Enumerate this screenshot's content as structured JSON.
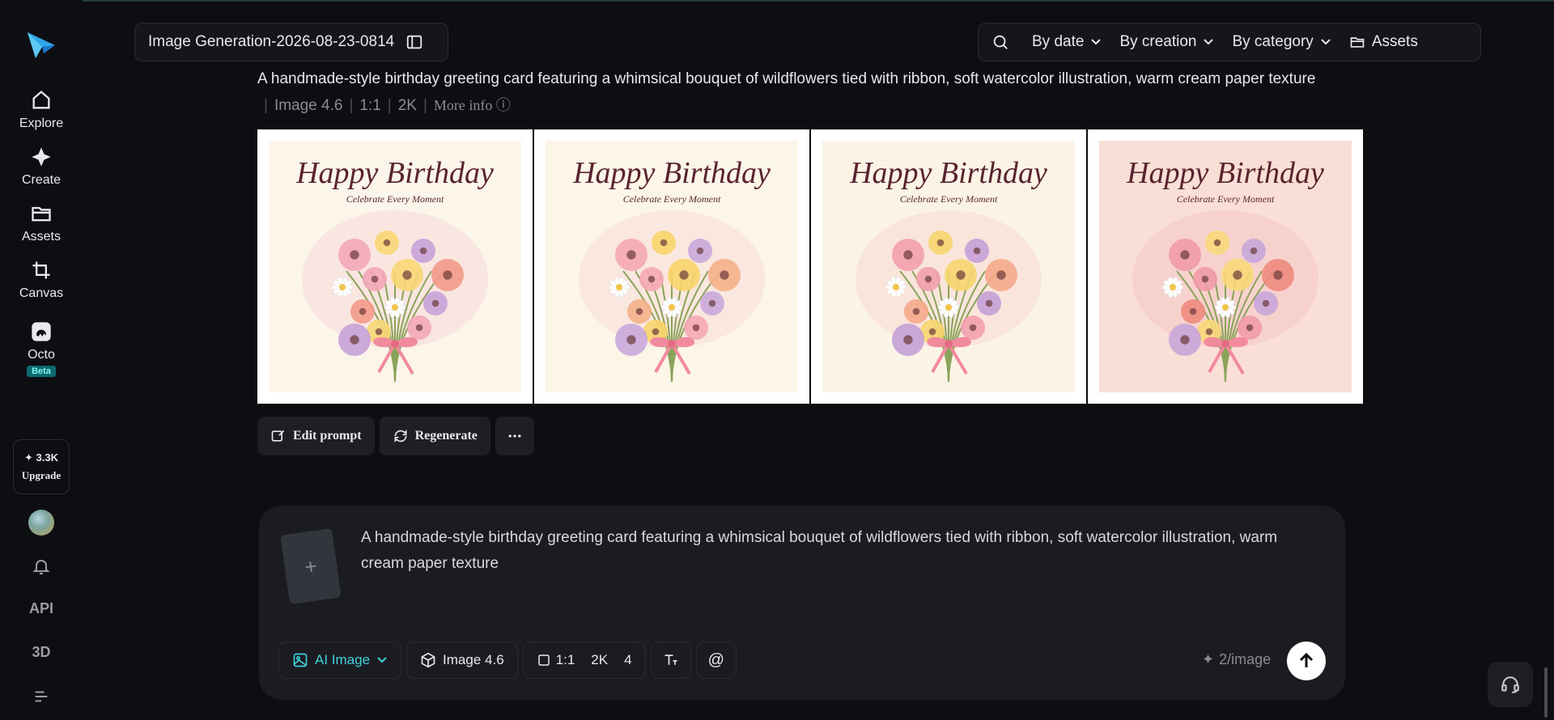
{
  "sidebar": {
    "items": [
      {
        "label": "Explore",
        "icon": "home-icon"
      },
      {
        "label": "Create",
        "icon": "diamond-icon"
      },
      {
        "label": "Assets",
        "icon": "folder-icon"
      },
      {
        "label": "Canvas",
        "icon": "crop-icon"
      },
      {
        "label": "Octo",
        "icon": "octo-icon",
        "badge": "Beta"
      }
    ],
    "upgrade": {
      "credits": "3.3K",
      "label": "Upgrade"
    },
    "api_label": "API",
    "three_d_label": "3D"
  },
  "header": {
    "title": "Image Generation-2026-08-23-0814",
    "filters": [
      "By date",
      "By creation",
      "By category"
    ],
    "assets_label": "Assets"
  },
  "result": {
    "prompt": "A handmade-style birthday greeting card featuring a whimsical bouquet of wildflowers tied with ribbon, soft watercolor illustration, warm cream paper texture",
    "model": "Image 4.6",
    "ratio": "1:1",
    "resolution": "2K",
    "more_info": "More info",
    "card_title": "Happy Birthday",
    "card_subtitle": "Celebrate Every Moment",
    "actions": {
      "edit": "Edit prompt",
      "regenerate": "Regenerate"
    }
  },
  "composer": {
    "text": "A handmade-style birthday greeting card featuring a whimsical bouquet of wildflowers tied with ribbon, soft watercolor illustration, warm cream paper texture",
    "mode": "AI Image",
    "model": "Image 4.6",
    "ratio": "1:1",
    "resolution": "2K",
    "count": "4",
    "cost": "2/image"
  },
  "colors": {
    "accent": "#3fd2dc",
    "background": "#0d0e12",
    "panel": "#1b1c22"
  }
}
